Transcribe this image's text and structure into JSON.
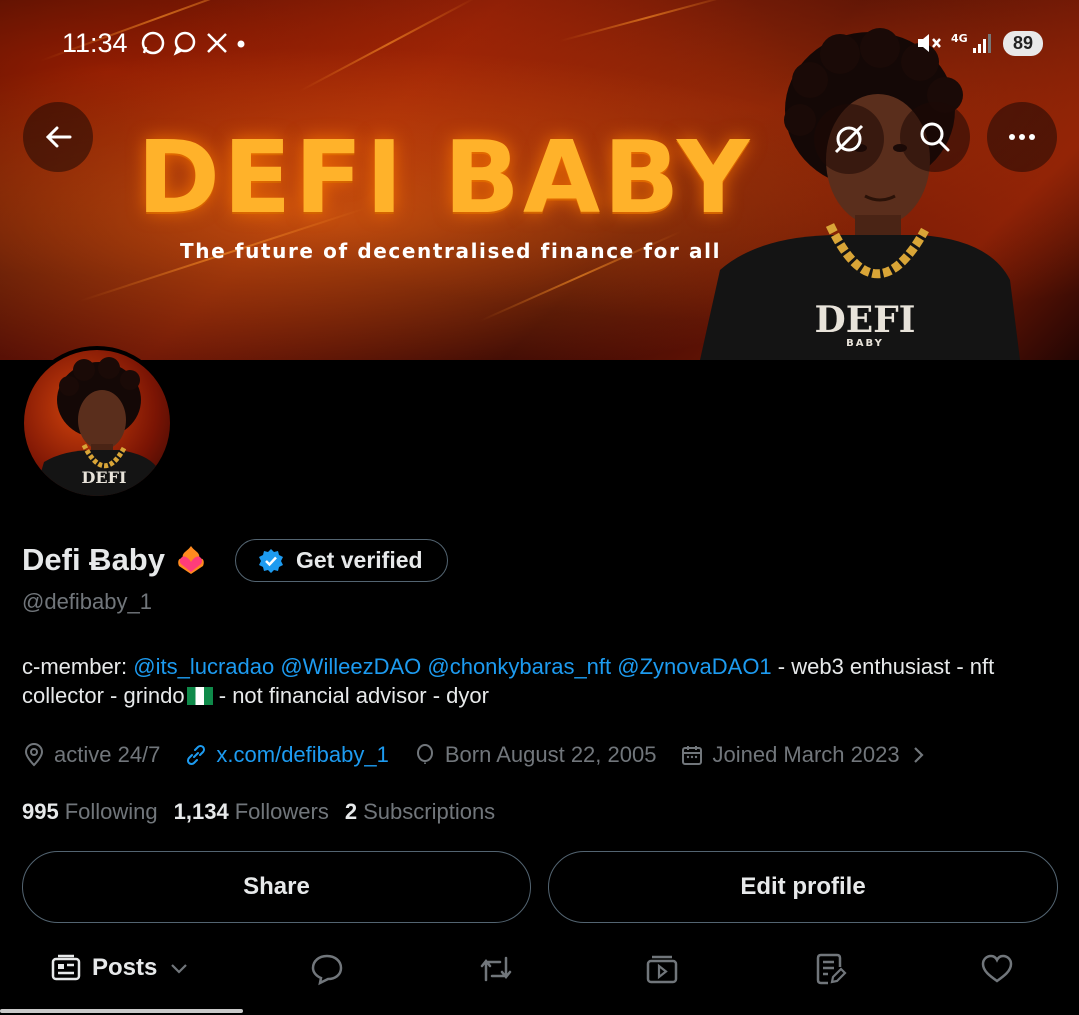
{
  "status_bar": {
    "time": "11:34",
    "battery": "89",
    "network": "4G"
  },
  "banner": {
    "title": "DEFI BABY",
    "subtitle": "The future of decentralised finance for all",
    "shirt_text": "DEFI",
    "shirt_subtext": "BABY"
  },
  "avatar": {
    "shirt_text": "DEFI"
  },
  "profile": {
    "display_name": "Defi Ƀaby",
    "verify_label": "Get verified",
    "handle": "@defibaby_1",
    "bio_prefix": "c-member: ",
    "bio_mentions": [
      "@its_lucradao",
      "@WilleezDAO",
      "@chonkybaras_nft",
      "@ZynovaDAO1"
    ],
    "bio_suffix_1": " - web3 enthusiast - nft",
    "bio_line2_start": "collector - grindo",
    "bio_line2_end": " - not financial advisor - dyor",
    "location": "active 24/7",
    "website": "x.com/defibaby_1",
    "birthday": "Born August 22, 2005",
    "joined": "Joined March 2023"
  },
  "stats": {
    "following_count": "995",
    "following_label": "Following",
    "followers_count": "1,134",
    "followers_label": "Followers",
    "subs_count": "2",
    "subs_label": "Subscriptions"
  },
  "actions": {
    "share": "Share",
    "edit": "Edit profile"
  },
  "tabs": {
    "posts": "Posts"
  },
  "colors": {
    "accent": "#1d9bf0",
    "muted": "#71767b",
    "border": "#536471",
    "fire": "#ffb22a"
  }
}
